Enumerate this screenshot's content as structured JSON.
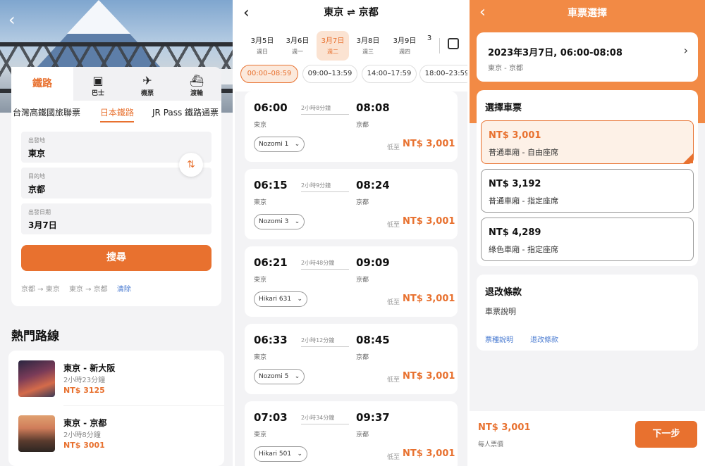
{
  "search_screen": {
    "tabs": [
      {
        "label": "鐵路",
        "icon": "train-icon"
      },
      {
        "label": "巴士",
        "icon": "bus-icon"
      },
      {
        "label": "機票",
        "icon": "plane-icon"
      },
      {
        "label": "渡輪",
        "icon": "ferry-icon"
      }
    ],
    "subtabs": [
      "台灣高鐵國旅聯票",
      "日本鐵路",
      "JR Pass 鐵路通票"
    ],
    "fields": [
      {
        "label": "出發地",
        "value": "東京"
      },
      {
        "label": "目的地",
        "value": "京都"
      },
      {
        "label": "出發日期",
        "value": "3月7日"
      }
    ],
    "search_label": "搜尋",
    "history": [
      "京都 → 東京",
      "東京 → 京都"
    ],
    "clear_label": "清除",
    "hot_title": "熱門路線",
    "routes": [
      {
        "title": "東京 - 新大阪",
        "duration": "2小時23分鐘",
        "price": "NT$ 3125"
      },
      {
        "title": "東京 - 京都",
        "duration": "2小時8分鐘",
        "price": "NT$ 3001"
      }
    ]
  },
  "results_screen": {
    "title": "東京 ⇌ 京都",
    "dates": [
      {
        "date": "3月5日",
        "day": "週日"
      },
      {
        "date": "3月6日",
        "day": "週一"
      },
      {
        "date": "3月7日",
        "day": "週二"
      },
      {
        "date": "3月8日",
        "day": "週三"
      },
      {
        "date": "3月9日",
        "day": "週四"
      }
    ],
    "date_more": "3",
    "time_slots": [
      "00:00–08:59",
      "09:00–13:59",
      "14:00–17:59",
      "18:00–23:59"
    ],
    "from_price_label": "低至",
    "trains": [
      {
        "dep": "06:00",
        "arr": "08:08",
        "duration": "2小時8分鐘",
        "from": "東京",
        "to": "京都",
        "train": "Nozomi 1",
        "price": "NT$ 3,001"
      },
      {
        "dep": "06:15",
        "arr": "08:24",
        "duration": "2小時9分鐘",
        "from": "東京",
        "to": "京都",
        "train": "Nozomi 3",
        "price": "NT$ 3,001"
      },
      {
        "dep": "06:21",
        "arr": "09:09",
        "duration": "2小時48分鐘",
        "from": "東京",
        "to": "京都",
        "train": "Hikari 631",
        "price": "NT$ 3,001"
      },
      {
        "dep": "06:33",
        "arr": "08:45",
        "duration": "2小時12分鐘",
        "from": "東京",
        "to": "京都",
        "train": "Nozomi 5",
        "price": "NT$ 3,001"
      },
      {
        "dep": "07:03",
        "arr": "09:37",
        "duration": "2小時34分鐘",
        "from": "東京",
        "to": "京都",
        "train": "Hikari 501",
        "price": "NT$ 3,001"
      }
    ]
  },
  "ticket_screen": {
    "title": "車票選擇",
    "trip_time": "2023年3月7日, 06:00-08:08",
    "trip_route": "東京 - 京都",
    "select_title": "選擇車票",
    "options": [
      {
        "price": "NT$ 3,001",
        "desc": "普通車廂 - 自由座席"
      },
      {
        "price": "NT$ 3,192",
        "desc": "普通車廂 - 指定座席"
      },
      {
        "price": "NT$ 4,289",
        "desc": "綠色車廂 - 指定座席"
      }
    ],
    "policy_title": "退改條款",
    "policy_sub": "車票說明",
    "link1": "票種說明",
    "link2": "退改條款",
    "total_price": "NT$ 3,001",
    "per_person": "每人票價",
    "next_label": "下一步"
  },
  "colors": {
    "accent": "#e8712f",
    "link": "#4a7bd1"
  }
}
